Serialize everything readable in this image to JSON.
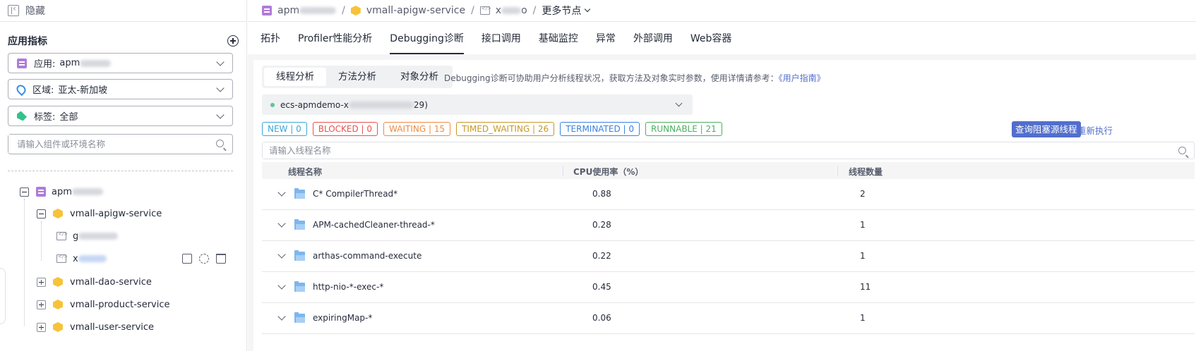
{
  "sidebar": {
    "hide_label": "隐藏",
    "title": "应用指标",
    "filters": {
      "app": {
        "label": "应用:",
        "value": "apm"
      },
      "region": {
        "label": "区域:",
        "value": "亚太-新加坡"
      },
      "tag": {
        "label": "标签:",
        "value": "全部"
      }
    },
    "search_placeholder": "请输入组件或环境名称",
    "tree": {
      "root": "apm",
      "service": "vmall-apigw-service",
      "instances": [
        "g",
        "x"
      ],
      "services": [
        "vmall-dao-service",
        "vmall-product-service",
        "vmall-user-service"
      ]
    }
  },
  "breadcrumb": {
    "app": "apm",
    "service": "vmall-apigw-service",
    "instance": "x",
    "instance_suffix": "o",
    "more": "更多节点"
  },
  "tabs": [
    "拓扑",
    "Profiler性能分析",
    "Debugging诊断",
    "接口调用",
    "基础监控",
    "异常",
    "外部调用",
    "Web容器"
  ],
  "active_tab": "Debugging诊断",
  "subtabs": [
    "线程分析",
    "方法分析",
    "对象分析"
  ],
  "hint": {
    "text": "Debugging诊断可协助用户分析线程状况，获取方法及对象实时参数，使用详情请参考：",
    "link": "《用户指南》"
  },
  "process": {
    "prefix": "ecs-apmdemo-x",
    "suffix": "29)"
  },
  "badges": [
    {
      "label": "NEW | 0",
      "color": "#3aa5d8"
    },
    {
      "label": "BLOCKED | 0",
      "color": "#e5524c"
    },
    {
      "label": "WAITING | 15",
      "color": "#ee8b43"
    },
    {
      "label": "TIMED_WAITING | 26",
      "color": "#c79826"
    },
    {
      "label": "TERMINATED | 0",
      "color": "#3a82e0"
    },
    {
      "label": "RUNNABLE | 21",
      "color": "#4caf5e"
    }
  ],
  "query_button": "查询阻塞源线程",
  "rerun_button": "重新执行",
  "thread_search_placeholder": "请输入线程名称",
  "table": {
    "headers": [
      "线程名称",
      "CPU使用率（%）",
      "线程数量"
    ],
    "rows": [
      {
        "name": "C* CompilerThread*",
        "cpu": "0.88",
        "count": "2"
      },
      {
        "name": "APM-cachedCleaner-thread-*",
        "cpu": "0.28",
        "count": "1"
      },
      {
        "name": "arthas-command-execute",
        "cpu": "0.22",
        "count": "1"
      },
      {
        "name": "http-nio-*-exec-*",
        "cpu": "0.45",
        "count": "11"
      },
      {
        "name": "expiringMap-*",
        "cpu": "0.06",
        "count": "1"
      }
    ]
  }
}
